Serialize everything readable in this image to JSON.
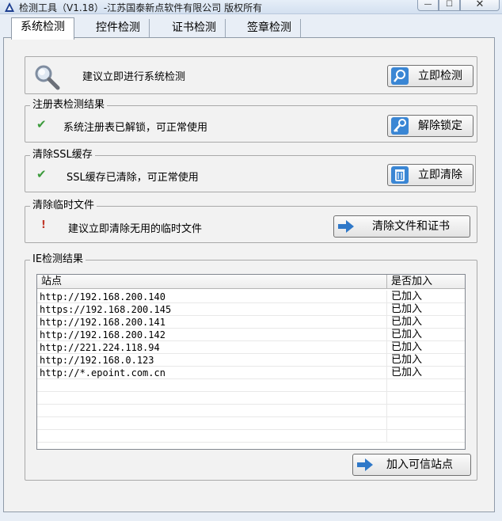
{
  "window": {
    "title": "检测工具（V1.18）-江苏国泰新点软件有限公司 版权所有",
    "min_glyph": "—",
    "max_glyph": "☐",
    "close_glyph": "✕"
  },
  "tabs": [
    {
      "label": "系统检测",
      "active": true
    },
    {
      "label": "控件检测",
      "active": false
    },
    {
      "label": "证书检测",
      "active": false
    },
    {
      "label": "签章检测",
      "active": false
    }
  ],
  "system_check": {
    "message": "建议立即进行系统检测",
    "button_label": "立即检测",
    "icon": "magnifier-icon"
  },
  "registry": {
    "legend": "注册表检测结果",
    "status_glyph": "✔",
    "message": "系统注册表已解锁，可正常使用",
    "button_label": "解除锁定",
    "icon": "key-icon"
  },
  "ssl": {
    "legend": "清除SSL缓存",
    "status_glyph": "✔",
    "message": "SSL缓存已清除，可正常使用",
    "button_label": "立即清除",
    "icon": "trash-icon"
  },
  "temp_files": {
    "legend": "清除临时文件",
    "status_glyph": "!",
    "message": "建议立即清除无用的临时文件",
    "button_label": "清除文件和证书",
    "icon": "arrow-right-icon"
  },
  "ie_check": {
    "legend": "IE检测结果",
    "columns": [
      "站点",
      "是否加入"
    ],
    "rows": [
      {
        "site": "http://192.168.200.140",
        "status": "已加入"
      },
      {
        "site": "https://192.168.200.145",
        "status": "已加入"
      },
      {
        "site": "http://192.168.200.141",
        "status": "已加入"
      },
      {
        "site": "http://192.168.200.142",
        "status": "已加入"
      },
      {
        "site": "http://221.224.118.94",
        "status": "已加入"
      },
      {
        "site": "http://192.168.0.123",
        "status": "已加入"
      },
      {
        "site": "http://*.epoint.com.cn",
        "status": "已加入"
      },
      {
        "site": "",
        "status": ""
      },
      {
        "site": "",
        "status": ""
      },
      {
        "site": "",
        "status": ""
      },
      {
        "site": "",
        "status": ""
      },
      {
        "site": "",
        "status": ""
      }
    ],
    "button_label": "加入可信站点"
  },
  "colors": {
    "check_green": "#3c9b3c",
    "warning_red": "#c0392b",
    "icon_blue": "#2f78c8"
  }
}
